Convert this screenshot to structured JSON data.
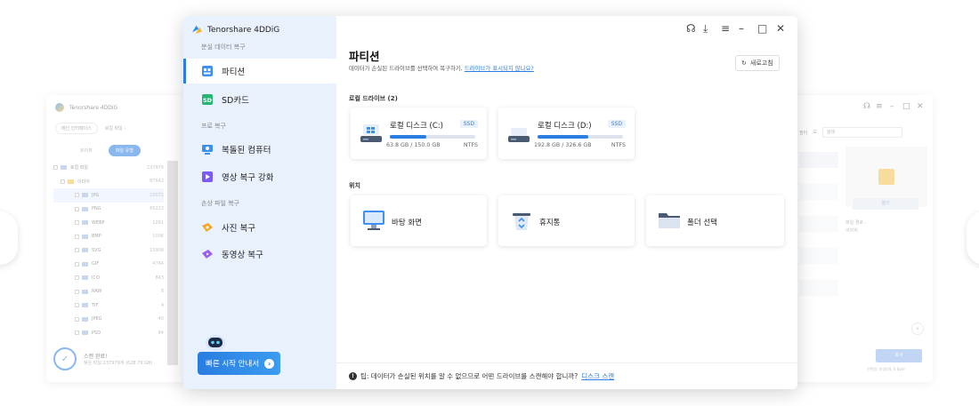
{
  "background_window": {
    "title": "Tenorshare 4DDiG",
    "home_tab": "메인 인터페이스",
    "path": "로컬 파일 ›",
    "view_tabs": [
      "트리뷰",
      "파일 유형"
    ],
    "tree": [
      {
        "label": "로컬 파일",
        "count": "237979"
      },
      {
        "label": "이미지",
        "count": "87642"
      },
      {
        "label": "JPG",
        "count": "10071"
      },
      {
        "label": "PNG",
        "count": "65233"
      },
      {
        "label": "WEBP",
        "count": "1261"
      },
      {
        "label": "BMP",
        "count": "1006"
      },
      {
        "label": "SVG",
        "count": "13908"
      },
      {
        "label": "GIF",
        "count": "4764"
      },
      {
        "label": "ICO",
        "count": "843"
      },
      {
        "label": "RAW",
        "count": "8"
      },
      {
        "label": "TIF",
        "count": "4"
      },
      {
        "label": "JPEG",
        "count": "40"
      },
      {
        "label": "PSD",
        "count": "84"
      }
    ],
    "status_title": "스캔 완료!",
    "status_detail": "찾은 파일:237979개 (628.79 GB)",
    "filter_label": "필터",
    "search_placeholder": "검색",
    "open_button": "열기",
    "meta_label": "파일 경로 :",
    "meta_value": "이미지",
    "recover_button": "복구",
    "selected_info": "선택됨: 파일0개, 0 Byte"
  },
  "app": {
    "title": "Tenorshare 4DDiG"
  },
  "sidebar": {
    "section_lost": "분실 데이터 복구",
    "section_pc": "프로 복구",
    "section_damaged": "손상 파일 복구",
    "items": [
      {
        "label": "파티션",
        "icon": "partition-icon"
      },
      {
        "label": "SD카드",
        "icon": "sd-card-icon"
      },
      {
        "label": "복돌된 컴퓨터",
        "icon": "crashed-computer-icon"
      },
      {
        "label": "영상 복구 강화",
        "icon": "video-enhance-icon"
      },
      {
        "label": "사진 복구",
        "icon": "photo-repair-icon"
      },
      {
        "label": "동영상 복구",
        "icon": "video-repair-icon"
      }
    ],
    "quick_start": "빠른 시작 안내서"
  },
  "main": {
    "title": "파티션",
    "subtitle": "데이터가 손실된 드라이브를 선택하여 복구하기,",
    "subtitle_link": "드라이브가 표시되지 않나요?",
    "refresh": "새로고침",
    "local_drives_label": "로컬 드라이브 (2)",
    "drives": [
      {
        "name": "로컬 디스크 (C:)",
        "badge": "SSD",
        "usage": "63.8 GB / 150.0 GB",
        "fs": "NTFS",
        "used_fraction": 0.425
      },
      {
        "name": "로컬 디스크 (D:)",
        "badge": "SSD",
        "usage": "192.8 GB / 326.6 GB",
        "fs": "NTFS",
        "used_fraction": 0.59
      }
    ],
    "locations_label": "위치",
    "locations": [
      {
        "name": "바탕 화면",
        "icon": "desktop-icon"
      },
      {
        "name": "휴지통",
        "icon": "recycle-bin-icon"
      },
      {
        "name": "폴더 선택",
        "icon": "folder-icon"
      }
    ],
    "tip_text": "팁: 데이터가 손실된 위치를 알 수 없으므로 어떤 드라이브를 스캔해야 합니까?",
    "tip_link": "디스크 스캔"
  },
  "colors": {
    "accent": "#2a7de1",
    "sidebar_bg": "#e9f1fd"
  }
}
